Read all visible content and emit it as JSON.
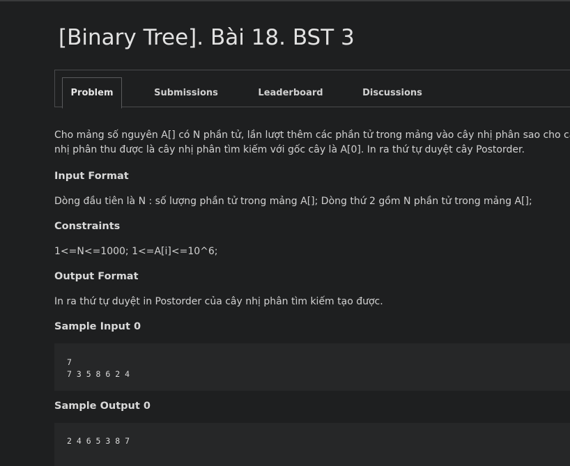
{
  "title": "[Binary Tree]. Bài 18. BST 3",
  "tabs": [
    {
      "label": "Problem",
      "active": true
    },
    {
      "label": "Submissions",
      "active": false
    },
    {
      "label": "Leaderboard",
      "active": false
    },
    {
      "label": "Discussions",
      "active": false
    }
  ],
  "problem": {
    "description_line1": "Cho mảng số nguyên A[] có N phần tử, lần lượt thêm các phần tử trong mảng vào cây nhị phân sao cho cây",
    "description_line2": "nhị phân thu được là cây nhị phân tìm kiếm với gốc cây là A[0]. In ra thứ tự duyệt cây Postorder.",
    "input_heading": "Input Format",
    "input_text": "Dòng đầu tiên là N : số lượng phần tử trong mảng A[]; Dòng thứ 2 gồm N phần tử trong mảng A[];",
    "constraints_heading": "Constraints",
    "constraints_text": "1<=N<=1000; 1<=A[i]<=10^6;",
    "output_heading": "Output Format",
    "output_text": "In ra thứ tự duyệt in Postorder của cây nhị phân tìm kiếm tạo được.",
    "sample_input_heading": "Sample Input 0",
    "sample_input": "7\n7 3 5 8 6 2 4",
    "sample_output_heading": "Sample Output 0",
    "sample_output": "2 4 6 5 3 8 7"
  },
  "colors": {
    "background": "#1e1f20",
    "code_background": "#262728",
    "border": "#4a4b4d"
  }
}
